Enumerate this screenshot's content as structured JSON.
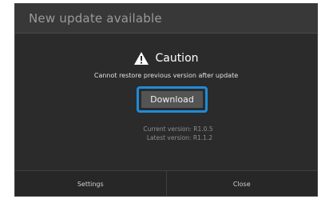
{
  "dialog": {
    "title": "New update available",
    "caution_heading": "Caution",
    "message": "Cannot restore previous version after update",
    "download_label": "Download",
    "current_version": "Current version: R1.0.5",
    "latest_version": "Latest version: R1.1.2",
    "accent_color": "#1e8cd8"
  },
  "buttons": {
    "settings_label": "Settings",
    "close_label": "Close"
  },
  "icons": {
    "caution": "warning-icon"
  }
}
